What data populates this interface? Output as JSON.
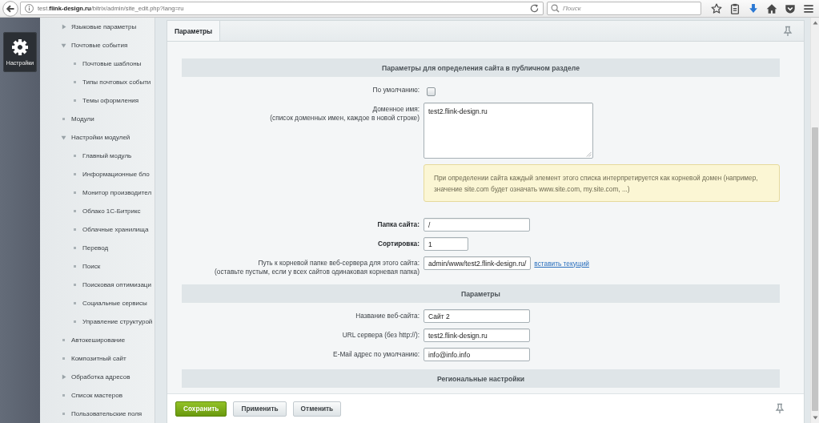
{
  "browser": {
    "url": "test.**flink-design.ru**/bitrix/admin/site_edit.php?lang=ru",
    "search_placeholder": "Поиск"
  },
  "app_menu": [
    {
      "label": "Настройки",
      "selected": true
    }
  ],
  "sidebar": {
    "items": [
      {
        "label": "Языковые параметры",
        "kind": "folder",
        "expanded": false,
        "selected": false
      },
      {
        "label": "Почтовые события",
        "kind": "folder",
        "expanded": true,
        "selected": false,
        "children": [
          {
            "label": "Почтовые шаблоны",
            "kind": "leaf",
            "selected": false
          },
          {
            "label": "Типы почтовых событи",
            "kind": "leaf",
            "selected": false
          },
          {
            "label": "Темы оформления",
            "kind": "leaf",
            "selected": false
          }
        ]
      },
      {
        "label": "Модули",
        "kind": "leaf",
        "selected": false
      },
      {
        "label": "Настройки модулей",
        "kind": "folder",
        "expanded": true,
        "selected": false,
        "children": [
          {
            "label": "Главный модуль",
            "kind": "leaf",
            "selected": false
          },
          {
            "label": "Информационные бло",
            "kind": "leaf",
            "selected": false
          },
          {
            "label": "Монитор производител",
            "kind": "leaf",
            "selected": false
          },
          {
            "label": "Облако 1С-Битрикс",
            "kind": "leaf",
            "selected": false
          },
          {
            "label": "Облачные хранилища",
            "kind": "leaf",
            "selected": false
          },
          {
            "label": "Перевод",
            "kind": "leaf",
            "selected": false
          },
          {
            "label": "Поиск",
            "kind": "leaf",
            "selected": false
          },
          {
            "label": "Поисковая оптимизаци",
            "kind": "leaf",
            "selected": false
          },
          {
            "label": "Социальные сервисы",
            "kind": "leaf",
            "selected": false
          },
          {
            "label": "Управление структурой",
            "kind": "leaf",
            "selected": false
          }
        ]
      },
      {
        "label": "Автокеширование",
        "kind": "leaf",
        "selected": false
      },
      {
        "label": "Композитный сайт",
        "kind": "leaf",
        "selected": false
      },
      {
        "label": "Обработка адресов",
        "kind": "folder",
        "expanded": false,
        "selected": false
      },
      {
        "label": "Список мастеров",
        "kind": "leaf",
        "selected": false
      },
      {
        "label": "Пользовательские поля",
        "kind": "leaf",
        "selected": false
      }
    ]
  },
  "tabs": [
    {
      "label": "Параметры",
      "selected": true
    }
  ],
  "form": {
    "sections": [
      {
        "title": "Параметры для определения сайта в публичном разделе",
        "rows": [
          {
            "kind": "checkbox",
            "label": "По умолчанию:",
            "checked": false
          },
          {
            "kind": "textarea",
            "label": "Доменное имя:",
            "hint": "(список доменных имен, каждое в новой строке)",
            "value": "test2.flink-design.ru"
          },
          {
            "kind": "note",
            "text": "При определении сайта каждый элемент этого списка интерпретируется как корневой домен (например, значение site.com будет означать www.site.com, my.site.com, ...)"
          },
          {
            "kind": "text",
            "label": "Папка сайта:",
            "required": true,
            "value": "/"
          },
          {
            "kind": "number",
            "label": "Сортировка:",
            "required": true,
            "value": "1"
          },
          {
            "kind": "text",
            "label": "Путь к корневой папке веб-сервера для этого сайта:",
            "hint": "(оставьте пустым, если у всех сайтов одинаковая корневая папка)",
            "required": false,
            "value": "admin/www/test2.flink-design.ru/",
            "link": "вставить текущий"
          }
        ]
      },
      {
        "title": "Параметры",
        "rows": [
          {
            "kind": "text",
            "label": "Название веб-сайта:",
            "required": false,
            "value": "Сайт 2"
          },
          {
            "kind": "text",
            "label": "URL сервера (без http://):",
            "required": false,
            "value": "test2.flink-design.ru"
          },
          {
            "kind": "text",
            "label": "E-Mail адрес по умолчанию:",
            "required": false,
            "value": "info@info.info"
          }
        ]
      },
      {
        "title": "Региональные настройки"
      }
    ]
  },
  "buttons": [
    {
      "label": "Сохранить",
      "kind": "primary"
    },
    {
      "label": "Применить",
      "kind": "default"
    },
    {
      "label": "Отменить",
      "kind": "default"
    }
  ]
}
